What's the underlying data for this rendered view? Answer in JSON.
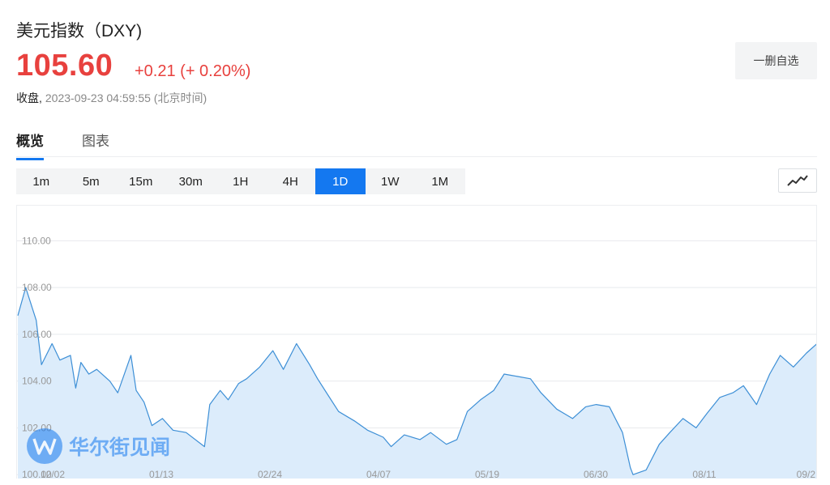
{
  "header": {
    "title": "美元指数（DXY)",
    "price": "105.60",
    "change": "+0.21 (+ 0.20%)",
    "status_label": "收盘,",
    "timestamp": "2023-09-23 04:59:55 (北京时间)",
    "watch_button": "一删自选",
    "up_color": "#e8413e"
  },
  "tabs": [
    {
      "label": "概览",
      "active": true
    },
    {
      "label": "图表",
      "active": false
    }
  ],
  "periods": [
    {
      "label": "1m"
    },
    {
      "label": "5m"
    },
    {
      "label": "15m"
    },
    {
      "label": "30m"
    },
    {
      "label": "1H"
    },
    {
      "label": "4H"
    },
    {
      "label": "1D",
      "active": true
    },
    {
      "label": "1W"
    },
    {
      "label": "1M"
    }
  ],
  "chart_type_icon": "line-chart-icon",
  "watermark": {
    "text": "华尔街见闻",
    "icon": "wallstreetcn-logo-icon"
  },
  "accent_color": "#1478f0",
  "chart_data": {
    "type": "area",
    "title": "",
    "xlabel": "",
    "ylabel": "",
    "ylim": [
      99.8,
      111.5
    ],
    "yticks": [
      "110.00",
      "108.00",
      "106.00",
      "104.00",
      "102.00",
      "100.00"
    ],
    "xticks": [
      "12/02",
      "01/13",
      "02/24",
      "04/07",
      "05/19",
      "06/30",
      "08/11",
      "09/2"
    ],
    "xrange": [
      "2022-11-22",
      "2023-09-22"
    ],
    "grid": true,
    "line_color": "#3d8fd6",
    "fill_color": "#dcecfb",
    "series": [
      {
        "x": [
          "2022-11-22",
          "2022-11-25",
          "2022-11-29",
          "2022-12-01",
          "2022-12-05",
          "2022-12-08",
          "2022-12-12",
          "2022-12-14",
          "2022-12-16",
          "2022-12-19",
          "2022-12-22",
          "2022-12-27",
          "2022-12-30",
          "2023-01-04",
          "2023-01-06",
          "2023-01-09",
          "2023-01-12",
          "2023-01-16",
          "2023-01-20",
          "2023-01-25",
          "2023-02-01",
          "2023-02-03",
          "2023-02-07",
          "2023-02-10",
          "2023-02-14",
          "2023-02-17",
          "2023-02-22",
          "2023-02-27",
          "2023-03-03",
          "2023-03-08",
          "2023-03-13",
          "2023-03-16",
          "2023-03-20",
          "2023-03-24",
          "2023-03-30",
          "2023-04-04",
          "2023-04-10",
          "2023-04-13",
          "2023-04-18",
          "2023-04-24",
          "2023-04-28",
          "2023-05-04",
          "2023-05-08",
          "2023-05-12",
          "2023-05-17",
          "2023-05-22",
          "2023-05-26",
          "2023-05-31",
          "2023-06-05",
          "2023-06-09",
          "2023-06-15",
          "2023-06-21",
          "2023-06-26",
          "2023-06-30",
          "2023-07-05",
          "2023-07-10",
          "2023-07-13",
          "2023-07-14",
          "2023-07-19",
          "2023-07-24",
          "2023-07-28",
          "2023-08-02",
          "2023-08-07",
          "2023-08-11",
          "2023-08-16",
          "2023-08-21",
          "2023-08-25",
          "2023-08-30",
          "2023-09-04",
          "2023-09-08",
          "2023-09-13",
          "2023-09-18",
          "2023-09-22"
        ],
        "y": [
          106.8,
          108.0,
          106.6,
          104.7,
          105.6,
          104.9,
          105.1,
          103.7,
          104.8,
          104.3,
          104.5,
          104.0,
          103.5,
          105.1,
          103.6,
          103.1,
          102.1,
          102.4,
          101.9,
          101.8,
          101.2,
          103.0,
          103.6,
          103.2,
          103.9,
          104.1,
          104.6,
          105.3,
          104.5,
          105.6,
          104.7,
          104.1,
          103.4,
          102.7,
          102.3,
          101.9,
          101.6,
          101.2,
          101.7,
          101.5,
          101.8,
          101.3,
          101.5,
          102.7,
          103.2,
          103.6,
          104.3,
          104.2,
          104.1,
          103.5,
          102.8,
          102.4,
          102.9,
          103.0,
          102.9,
          101.8,
          100.3,
          100.0,
          100.2,
          101.3,
          101.8,
          102.4,
          102.0,
          102.6,
          103.3,
          103.5,
          103.8,
          103.0,
          104.3,
          105.1,
          104.6,
          105.2,
          105.6
        ]
      }
    ]
  }
}
